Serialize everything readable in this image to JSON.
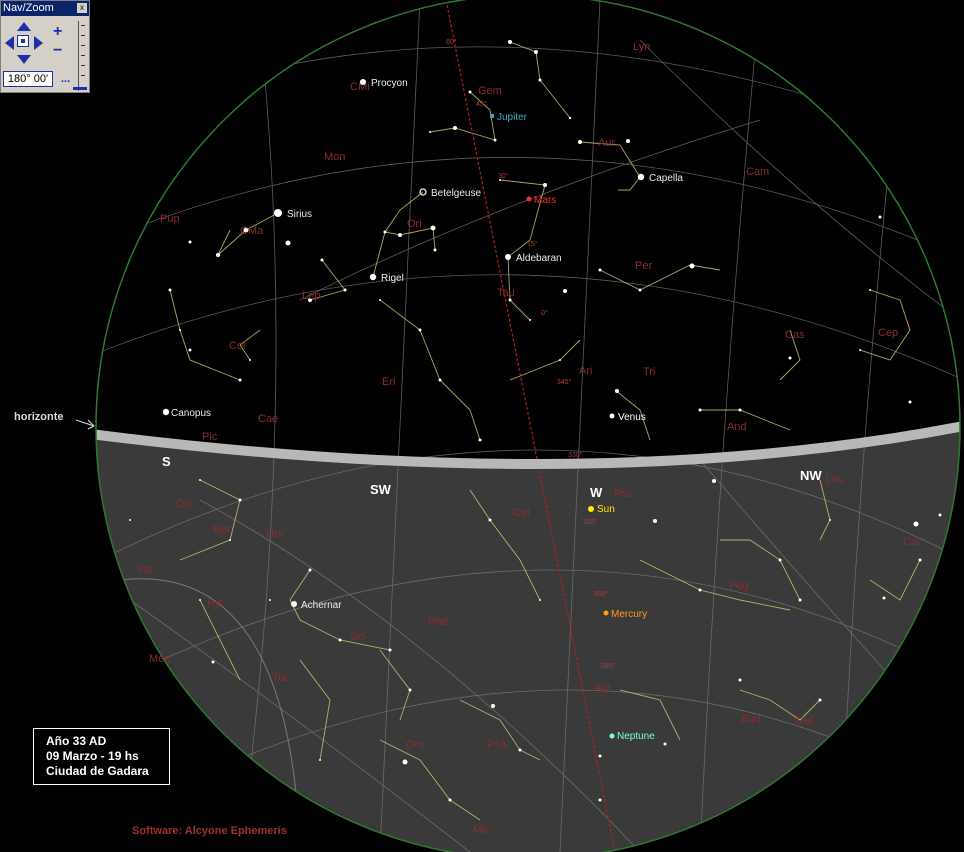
{
  "navzoom": {
    "title": "Nav/Zoom",
    "close": "x",
    "zoom_in": "+",
    "zoom_out": "−",
    "angle_value": "180° 00'",
    "more": "..."
  },
  "info": {
    "line1": "Año 33 AD",
    "line2": "09 Marzo - 19 hs",
    "line3": "Ciudad de Gadara"
  },
  "horizon_label": "horizonte",
  "software_credit": "Software: Alcyone Ephemeris",
  "cardinals": {
    "S": "S",
    "SW": "SW",
    "W": "W",
    "NW": "NW"
  },
  "stars": {
    "procyon": "Procyon",
    "betelgeuse": "Betelgeuse",
    "sirius": "Sirius",
    "rigel": "Rigel",
    "aldebaran": "Aldebaran",
    "capella": "Capella",
    "canopus": "Canopus",
    "achernar": "Achernar"
  },
  "planets": {
    "jupiter": "Jupiter",
    "mars": "Mars",
    "venus": "Venus",
    "sun": "Sun",
    "mercury": "Mercury",
    "neptune": "Neptune"
  },
  "constellations": {
    "lyn": "Lyn",
    "cmi": "CMi",
    "gem": "Gem",
    "aur": "Aur",
    "cam": "Cam",
    "mon": "Mon",
    "ori": "Ori",
    "pup": "Pup",
    "cma": "CMa",
    "per": "Per",
    "tau": "Tau",
    "lep": "Lep",
    "cas": "Cas",
    "cep": "Cep",
    "col": "Col",
    "eri": "Eri",
    "ari": "Ari",
    "tri": "Tri",
    "cae": "Cae",
    "pic": "Pic",
    "and": "And",
    "dor": "Dor",
    "lac": "Lac",
    "ret": "Ret",
    "hor": "Hor",
    "cet": "Cet",
    "psc": "Psc",
    "peg": "Peg",
    "vol": "Vol",
    "hyi": "Hyi",
    "phe": "Phe",
    "scl": "Scl",
    "tuc": "Tuc",
    "car": "Car",
    "gru": "Gru",
    "aqr": "Aqr",
    "psa": "PsA",
    "equ": "Equ",
    "del": "Del",
    "mic": "Mic",
    "men": "Men"
  },
  "ecliptic_ticks": [
    "60°",
    "45°",
    "30°",
    "15°",
    "0°",
    "345°",
    "330°",
    "315°",
    "300°",
    "285°"
  ],
  "colors": {
    "sky": "#000000",
    "ground": "#3a3a3a",
    "horizon": "#b8b8b8",
    "grid": "#7b7b7b",
    "constellation_line": "#c8c86e",
    "constellation_name": "#8a2d2d",
    "ecliptic": "#b31f1f",
    "jupiter": "#3fa7b8",
    "mars": "#ff2a2a",
    "sun": "#ffea00",
    "mercury": "#ff9a1a",
    "neptune": "#7fffd4",
    "venus": "#ffffff"
  }
}
